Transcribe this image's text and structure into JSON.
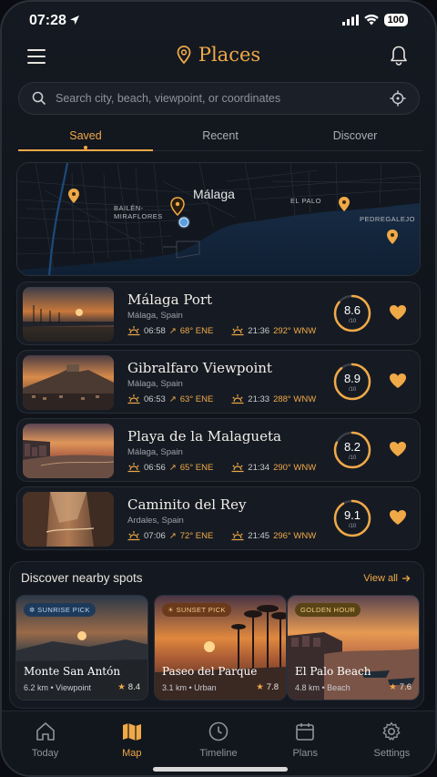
{
  "status": {
    "time": "07:28",
    "battery": "100"
  },
  "header": {
    "title": "Places"
  },
  "search": {
    "placeholder": "Search city, beach, viewpoint, or coordinates"
  },
  "tabs": [
    {
      "label": "Saved",
      "active": true
    },
    {
      "label": "Recent",
      "active": false
    },
    {
      "label": "Discover",
      "active": false
    }
  ],
  "map": {
    "city": "Málaga",
    "labels": [
      "BAILÉN-\nMIRAFLORES",
      "EL PALO",
      "PEDREGALEJO"
    ],
    "colors": {
      "sea": "#13243a",
      "land": "#11161e",
      "pin": "#f0a947",
      "current": "#5aa0e0"
    }
  },
  "places": [
    {
      "name": "Málaga Port",
      "location": "Málaga, Spain",
      "sunrise": "06:58",
      "sunrise_az": "68° ENE",
      "sunset": "21:36",
      "sunset_az": "292° WNW",
      "score": "8.6",
      "score_max": "/10",
      "score_fraction": 0.86,
      "favorite": true
    },
    {
      "name": "Gibralfaro Viewpoint",
      "location": "Málaga, Spain",
      "sunrise": "06:53",
      "sunrise_az": "63° ENE",
      "sunset": "21:33",
      "sunset_az": "288° WNW",
      "score": "8.9",
      "score_max": "/10",
      "score_fraction": 0.89,
      "favorite": true
    },
    {
      "name": "Playa de la Malagueta",
      "location": "Málaga, Spain",
      "sunrise": "06:56",
      "sunrise_az": "65° ENE",
      "sunset": "21:34",
      "sunset_az": "290° WNW",
      "score": "8.2",
      "score_max": "/10",
      "score_fraction": 0.82,
      "favorite": true
    },
    {
      "name": "Caminito del Rey",
      "location": "Ardales, Spain",
      "sunrise": "07:06",
      "sunrise_az": "72° ENE",
      "sunset": "21:45",
      "sunset_az": "296° WNW",
      "score": "9.1",
      "score_max": "/10",
      "score_fraction": 0.91,
      "favorite": true
    }
  ],
  "discover": {
    "title": "Discover nearby spots",
    "view_all": "View all",
    "spots": [
      {
        "badge": "SUNRISE PICK",
        "name": "Monte San Antón",
        "meta": "6.2 km • Viewpoint",
        "rating": "8.4"
      },
      {
        "badge": "SUNSET PICK",
        "name": "Paseo del Parque",
        "meta": "3.1 km • Urban",
        "rating": "7.8"
      },
      {
        "badge": "GOLDEN HOUR",
        "name": "El Palo Beach",
        "meta": "4.8 km • Beach",
        "rating": "7.6"
      }
    ]
  },
  "nav": [
    {
      "label": "Today",
      "icon": "home-icon",
      "active": false
    },
    {
      "label": "Map",
      "icon": "map-icon",
      "active": true
    },
    {
      "label": "Timeline",
      "icon": "clock-icon",
      "active": false
    },
    {
      "label": "Plans",
      "icon": "calendar-icon",
      "active": false
    },
    {
      "label": "Settings",
      "icon": "gear-icon",
      "active": false
    }
  ],
  "colors": {
    "accent": "#f0a947",
    "background": "#10141b",
    "card": "#161b23"
  }
}
